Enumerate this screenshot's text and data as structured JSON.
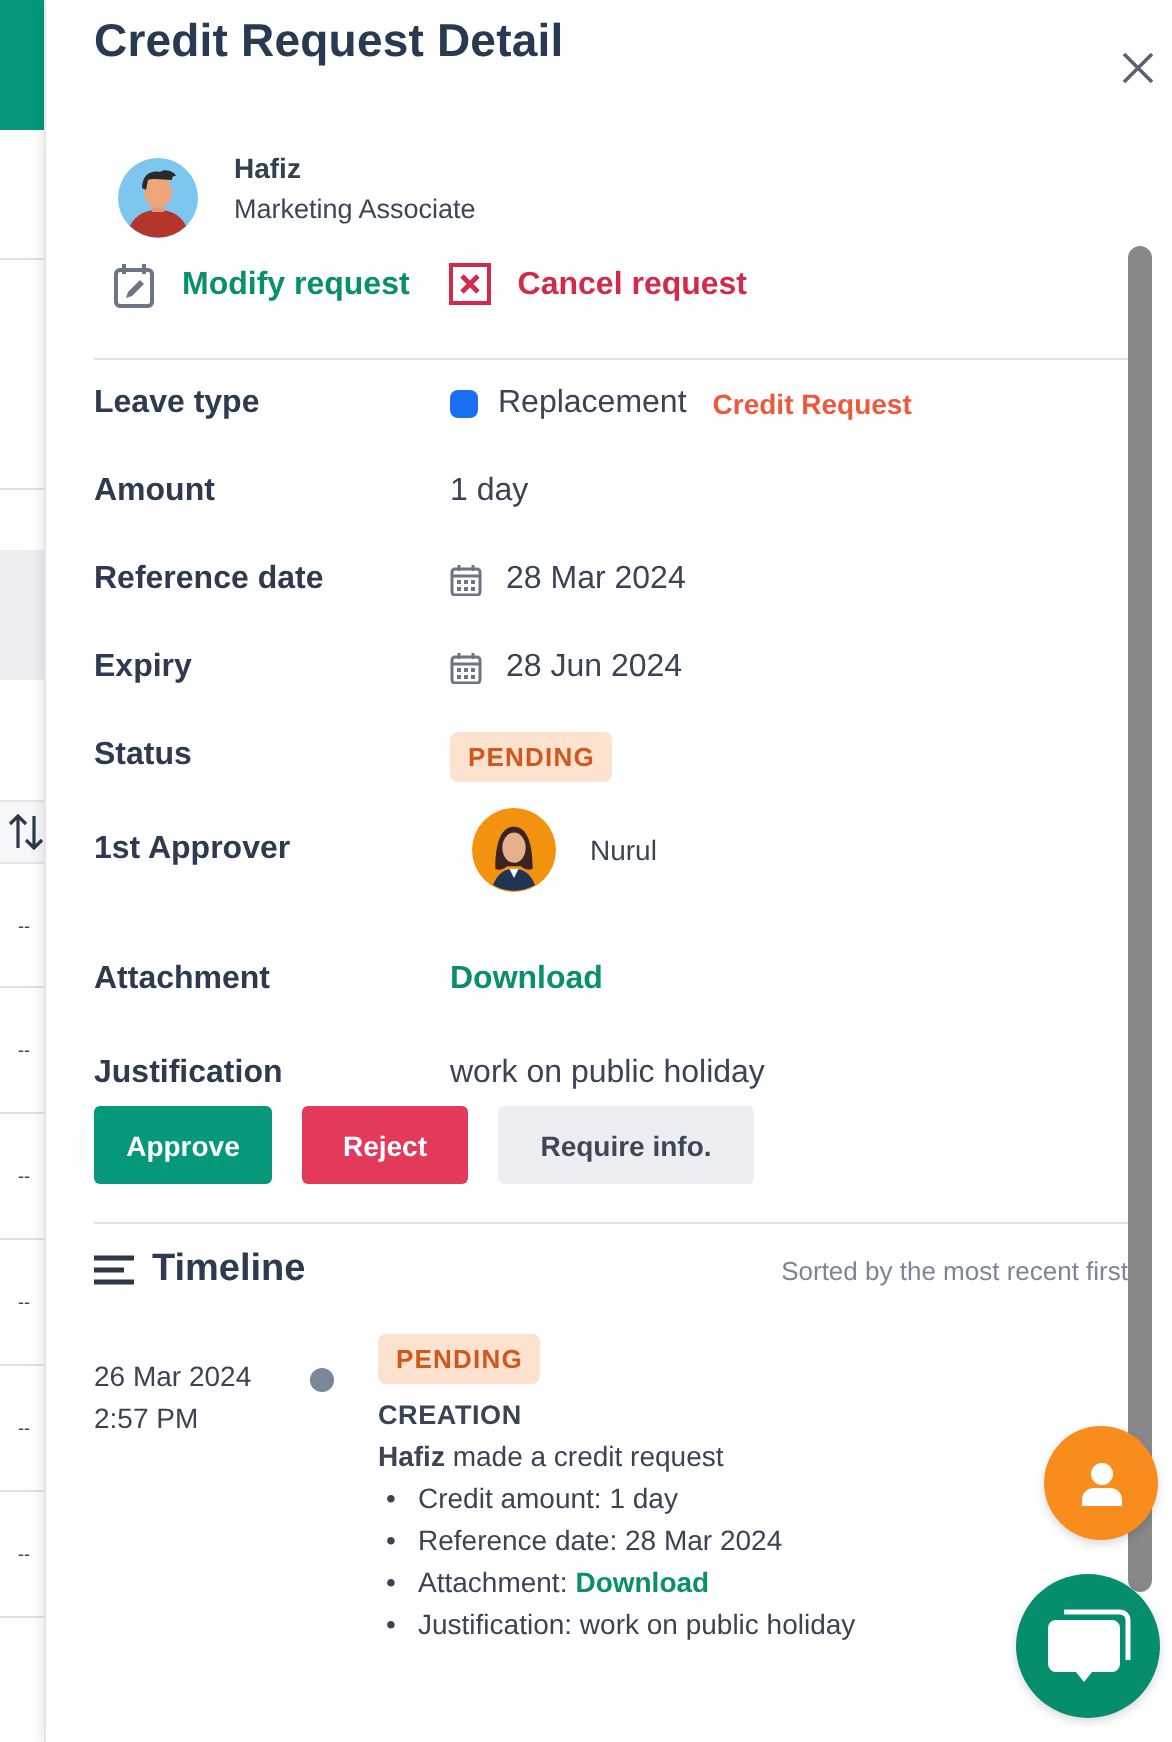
{
  "background": {
    "row_marks": [
      "--",
      "--",
      "--",
      "--",
      "--",
      "--"
    ]
  },
  "drawer": {
    "title": "Credit Request Detail",
    "requester": {
      "name": "Hafiz",
      "role": "Marketing Associate"
    },
    "actions": [
      {
        "label": "Modify request",
        "kind": "modify"
      },
      {
        "label": "Cancel request",
        "kind": "cancel"
      }
    ],
    "fields": [
      {
        "label": "Leave type",
        "kind": "leave_type",
        "value": "Replacement",
        "color": "#1a6ef5",
        "tag": "Credit Request"
      },
      {
        "label": "Amount",
        "kind": "text",
        "value": "1 day"
      },
      {
        "label": "Reference date",
        "kind": "date",
        "value": "28 Mar 2024"
      },
      {
        "label": "Expiry",
        "kind": "date",
        "value": "28 Jun 2024"
      },
      {
        "label": "Status",
        "kind": "status",
        "value": "PENDING"
      },
      {
        "label": "1st Approver",
        "kind": "person",
        "value": "Nurul"
      },
      {
        "label": "Attachment",
        "kind": "link",
        "value": "Download"
      },
      {
        "label": "Justification",
        "kind": "text",
        "value": "work on public holiday"
      }
    ],
    "buttons": [
      {
        "label": "Approve",
        "kind": "approve"
      },
      {
        "label": "Reject",
        "kind": "reject"
      },
      {
        "label": "Require info.",
        "kind": "info"
      }
    ],
    "timeline": {
      "title": "Timeline",
      "sort_note": "Sorted by the most recent first",
      "entries": [
        {
          "date": "26 Mar 2024",
          "time": "2:57 PM",
          "status": "PENDING",
          "event": "CREATION",
          "summary": "**Hafiz** made a credit request",
          "details": [
            {
              "marker": "•",
              "text": "Credit amount: 1 day"
            },
            {
              "marker": "•",
              "text": "Reference date: 28 Mar 2024"
            },
            {
              "marker": "•",
              "text": "Attachment:",
              "link": "Download"
            },
            {
              "marker": "•",
              "text": "Justification: work on public holiday"
            }
          ]
        }
      ]
    }
  }
}
